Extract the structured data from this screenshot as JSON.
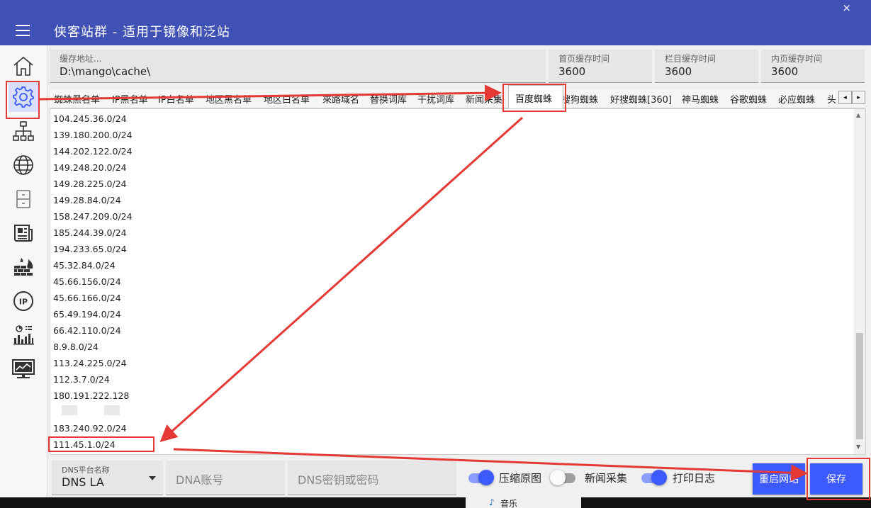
{
  "app": {
    "title": "侠客站群 - 适用于镜像和泛站",
    "close_label": "×"
  },
  "sidebar": {
    "items": [
      "home",
      "settings",
      "sitemap",
      "globe",
      "cabinet",
      "news",
      "firewall",
      "ip",
      "stats",
      "monitor"
    ],
    "ip_label": "IP"
  },
  "fields": {
    "cache_path": {
      "label": "缓存地址...",
      "value": "D:\\mango\\cache\\"
    },
    "home_cache": {
      "label": "首页缓存时间",
      "value": "3600"
    },
    "column_cache": {
      "label": "栏目缓存时间",
      "value": "3600"
    },
    "inner_cache": {
      "label": "内页缓存时间",
      "value": "3600"
    }
  },
  "tabs": [
    "蜘蛛黑名单",
    "IP黑名单",
    "IP白名单",
    "地区黑名单",
    "地区白名单",
    "來路域名",
    "替换词库",
    "干扰词库",
    "新闻采集",
    "百度蜘蛛",
    "搜狗蜘蛛",
    "好搜蜘蛛[360]",
    "神马蜘蛛",
    "谷歌蜘蛛",
    "必应蜘蛛",
    "头"
  ],
  "active_tab": "百度蜘蛛",
  "tab_nav": {
    "prev": "◂",
    "next": "▸"
  },
  "ip_list": [
    "104.245.36.0/24",
    "139.180.200.0/24",
    "144.202.122.0/24",
    "149.248.20.0/24",
    "149.28.225.0/24",
    "149.28.84.0/24",
    "158.247.209.0/24",
    "185.244.39.0/24",
    "194.233.65.0/24",
    "45.32.84.0/24",
    "45.66.156.0/24",
    "45.66.166.0/24",
    "65.49.194.0/24",
    "66.42.110.0/24",
    "8.9.8.0/24",
    "113.24.225.0/24",
    "112.3.7.0/24",
    "180.191.222.128",
    "",
    "183.240.92.0/24",
    "111.45.1.0/24"
  ],
  "scroll": {
    "up": "▲",
    "down": "▼"
  },
  "dns": {
    "platform_label": "DNS平台名称",
    "platform_value": "DNS LA",
    "account_placeholder": "DNA账号",
    "secret_placeholder": "DNS密钥或密码"
  },
  "toggles": [
    {
      "label": "压缩原图",
      "on": true
    },
    {
      "label": "新闻采集",
      "on": false
    },
    {
      "label": "打印日志",
      "on": true
    }
  ],
  "buttons": {
    "restart": "重启网站",
    "save": "保存"
  },
  "taskbar": {
    "music": "音乐"
  },
  "colors": {
    "primary": "#3f51b5",
    "accent": "#3d5afe",
    "annotation": "#e53935"
  }
}
